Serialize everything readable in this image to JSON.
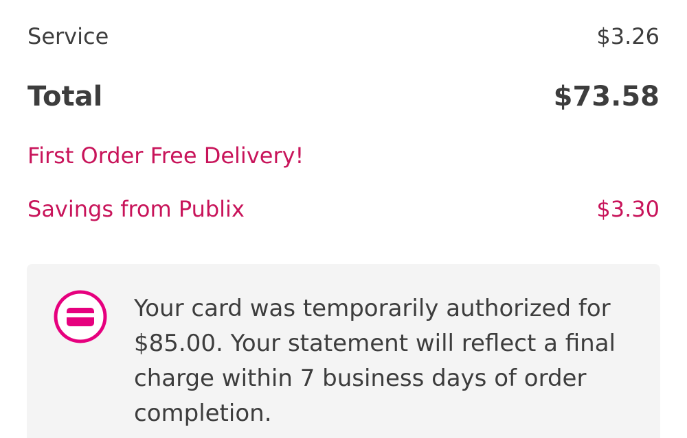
{
  "order_summary": {
    "service": {
      "label": "Service",
      "value": "$3.26"
    },
    "total": {
      "label": "Total",
      "value": "$73.58"
    },
    "promo": {
      "label": "First Order Free Delivery!"
    },
    "savings": {
      "label": "Savings from Publix",
      "value": "$3.30"
    }
  },
  "notice": {
    "icon": "credit-card-icon",
    "text": "Your card was temporarily authorized for $85.00. Your statement will reflect a final charge within 7 business days of order completion."
  },
  "colors": {
    "accent": "#c8145a",
    "icon_pink": "#e6007e",
    "text": "#3d3d3d",
    "notice_bg": "#f4f4f4"
  }
}
